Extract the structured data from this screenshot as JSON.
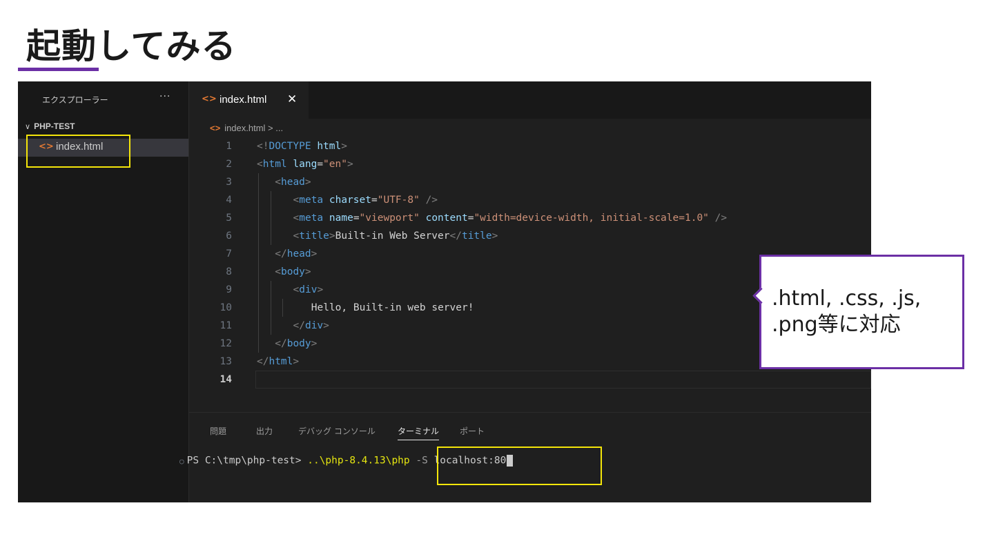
{
  "slide": {
    "title": "起動してみる"
  },
  "explorer": {
    "header": "エクスプローラー",
    "more": "···",
    "folder": "PHP-TEST",
    "file": "index.html"
  },
  "editor": {
    "tab_label": "index.html",
    "tab_close": "✕",
    "breadcrumb": "index.html > ...",
    "lines": [
      {
        "n": "1",
        "tokens": [
          [
            "p",
            "<!"
          ],
          [
            "tag",
            "DOCTYPE"
          ],
          [
            "text",
            " "
          ],
          [
            "attr",
            "html"
          ],
          [
            "p",
            ">"
          ]
        ]
      },
      {
        "n": "2",
        "tokens": [
          [
            "p",
            "<"
          ],
          [
            "tag",
            "html"
          ],
          [
            "text",
            " "
          ],
          [
            "attr",
            "lang"
          ],
          [
            "text",
            "="
          ],
          [
            "str",
            "\"en\""
          ],
          [
            "p",
            ">"
          ]
        ]
      },
      {
        "n": "3",
        "indent": 1,
        "tokens": [
          [
            "p",
            "<"
          ],
          [
            "tag",
            "head"
          ],
          [
            "p",
            ">"
          ]
        ]
      },
      {
        "n": "4",
        "indent": 2,
        "tokens": [
          [
            "p",
            "<"
          ],
          [
            "tag",
            "meta"
          ],
          [
            "text",
            " "
          ],
          [
            "attr",
            "charset"
          ],
          [
            "text",
            "="
          ],
          [
            "str",
            "\"UTF-8\""
          ],
          [
            "text",
            " "
          ],
          [
            "p",
            "/>"
          ]
        ]
      },
      {
        "n": "5",
        "indent": 2,
        "tokens": [
          [
            "p",
            "<"
          ],
          [
            "tag",
            "meta"
          ],
          [
            "text",
            " "
          ],
          [
            "attr",
            "name"
          ],
          [
            "text",
            "="
          ],
          [
            "str",
            "\"viewport\""
          ],
          [
            "text",
            " "
          ],
          [
            "attr",
            "content"
          ],
          [
            "text",
            "="
          ],
          [
            "str",
            "\"width=device-width, initial-scale=1.0\""
          ],
          [
            "text",
            " "
          ],
          [
            "p",
            "/>"
          ]
        ]
      },
      {
        "n": "6",
        "indent": 2,
        "tokens": [
          [
            "p",
            "<"
          ],
          [
            "tag",
            "title"
          ],
          [
            "p",
            ">"
          ],
          [
            "text",
            "Built-in Web Server"
          ],
          [
            "p",
            "</"
          ],
          [
            "tag",
            "title"
          ],
          [
            "p",
            ">"
          ]
        ]
      },
      {
        "n": "7",
        "indent": 1,
        "tokens": [
          [
            "p",
            "</"
          ],
          [
            "tag",
            "head"
          ],
          [
            "p",
            ">"
          ]
        ]
      },
      {
        "n": "8",
        "indent": 1,
        "tokens": [
          [
            "p",
            "<"
          ],
          [
            "tag",
            "body"
          ],
          [
            "p",
            ">"
          ]
        ]
      },
      {
        "n": "9",
        "indent": 2,
        "tokens": [
          [
            "p",
            "<"
          ],
          [
            "tag",
            "div"
          ],
          [
            "p",
            ">"
          ]
        ]
      },
      {
        "n": "10",
        "indent": 3,
        "tokens": [
          [
            "text",
            "Hello, Built-in web server!"
          ]
        ]
      },
      {
        "n": "11",
        "indent": 2,
        "tokens": [
          [
            "p",
            "</"
          ],
          [
            "tag",
            "div"
          ],
          [
            "p",
            ">"
          ]
        ]
      },
      {
        "n": "12",
        "indent": 1,
        "tokens": [
          [
            "p",
            "</"
          ],
          [
            "tag",
            "body"
          ],
          [
            "p",
            ">"
          ]
        ]
      },
      {
        "n": "13",
        "tokens": [
          [
            "p",
            "</"
          ],
          [
            "tag",
            "html"
          ],
          [
            "p",
            ">"
          ]
        ]
      },
      {
        "n": "14",
        "active": true,
        "tokens": []
      }
    ]
  },
  "panel": {
    "tabs": [
      "問題",
      "出力",
      "デバッグ コンソール",
      "ターミナル",
      "ポート"
    ],
    "active_tab": 3,
    "terminal": {
      "prompt": "PS C:\\tmp\\php-test> ",
      "path": "..\\php-8.4.13\\php",
      "flag": " -S",
      "arg": " localhost:80"
    }
  },
  "callout": {
    "text": ".html, .css, .js, .png等に対応"
  },
  "colors": {
    "accent": "#6b2fa5",
    "highlight": "#f5e60a",
    "editor_bg": "#1f1f1f",
    "sidebar_bg": "#181818"
  }
}
